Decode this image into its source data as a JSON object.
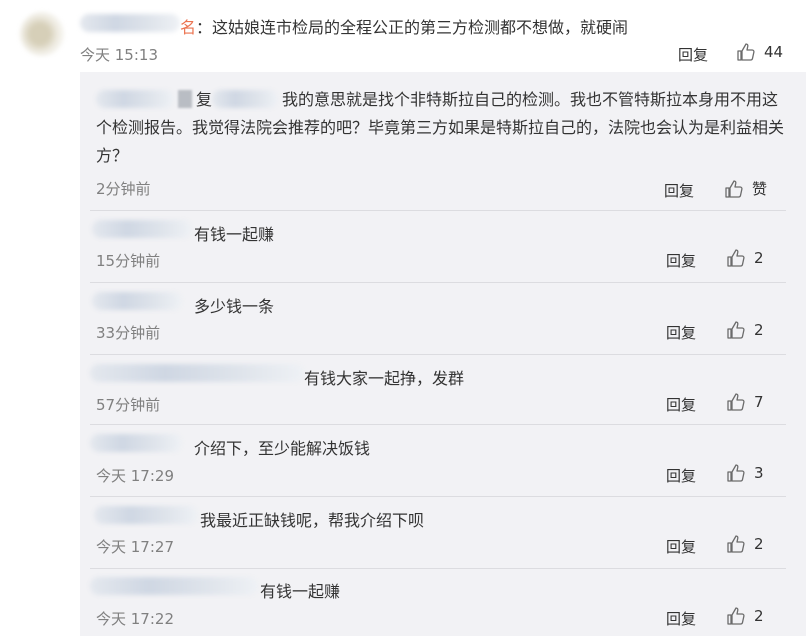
{
  "main_comment": {
    "name_suffix": "名",
    "text": "：这姑娘连市检局的全程公正的第三方检测都不想做，就硬闹",
    "time": "今天 15:13",
    "reply_label": "回复",
    "like_count": "44"
  },
  "replies": [
    {
      "prefix": "复",
      "text": "我的意思就是找个非特斯拉自己的检测。我也不管特斯拉本身用不用这个检测报告。我觉得法院会推荐的吧？毕竟第三方如果是特斯拉自己的，法院也会认为是利益相关方？",
      "time": "2分钟前",
      "reply_label": "回复",
      "like_count": "赞"
    },
    {
      "text": "有钱一起赚",
      "time": "15分钟前",
      "reply_label": "回复",
      "like_count": "2"
    },
    {
      "text": "多少钱一条",
      "time": "33分钟前",
      "reply_label": "回复",
      "like_count": "2"
    },
    {
      "text": "有钱大家一起挣，发群",
      "time": "57分钟前",
      "reply_label": "回复",
      "like_count": "7"
    },
    {
      "text": "介绍下，至少能解决饭钱",
      "time": "今天 17:29",
      "reply_label": "回复",
      "like_count": "3"
    },
    {
      "text": "我最近正缺钱呢，帮我介绍下呗",
      "time": "今天 17:27",
      "reply_label": "回复",
      "like_count": "2"
    },
    {
      "text": "有钱一起赚",
      "time": "今天 17:22",
      "reply_label": "回复",
      "like_count": "2"
    }
  ],
  "icons": {
    "like": "thumbs-up-icon"
  },
  "colors": {
    "link": "#eb7350",
    "meta": "#808080",
    "panel": "#f2f2f5"
  }
}
